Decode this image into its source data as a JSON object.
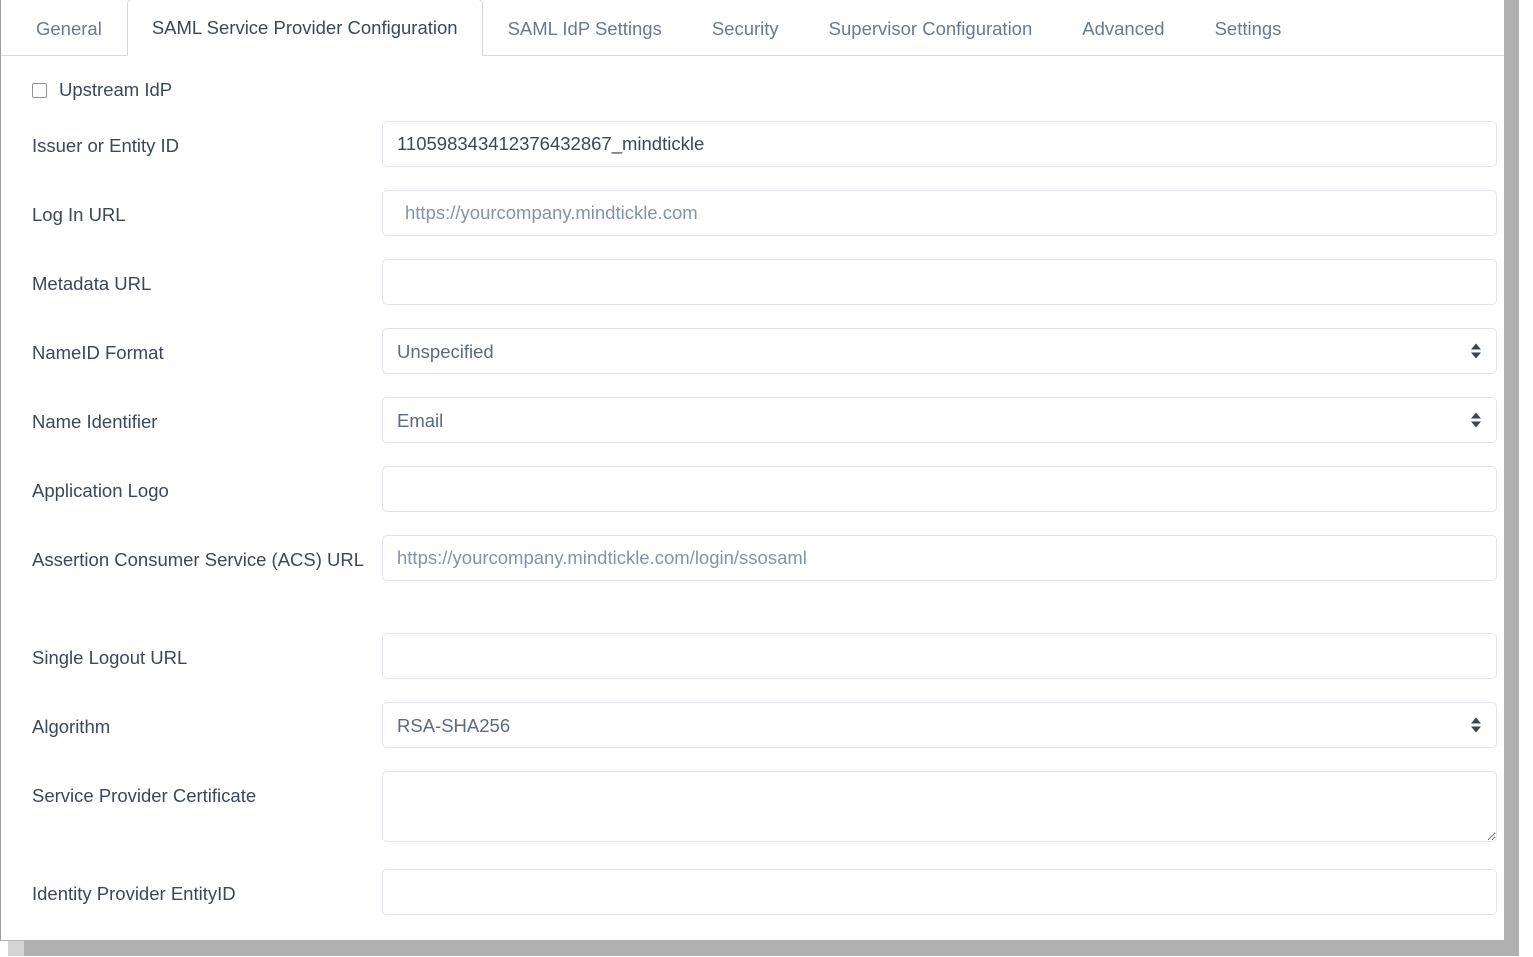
{
  "window": {
    "tabs": [
      {
        "label": "General",
        "active": false,
        "name": "tab-general"
      },
      {
        "label": "SAML Service Provider Configuration",
        "active": true,
        "name": "tab-saml-service-provider-configuration"
      },
      {
        "label": "SAML IdP Settings",
        "active": false,
        "name": "tab-saml-idp-settings"
      },
      {
        "label": "Security",
        "active": false,
        "name": "tab-security"
      },
      {
        "label": "Supervisor Configuration",
        "active": false,
        "name": "tab-supervisor-configuration"
      },
      {
        "label": "Advanced",
        "active": false,
        "name": "tab-advanced"
      },
      {
        "label": "Settings",
        "active": false,
        "name": "tab-settings"
      }
    ]
  },
  "colors": {
    "active_tab_text": "#3c4858",
    "inactive_tab_text": "#6c7a8d",
    "label_text": "#3c4858",
    "placeholder_text": "#8593a8",
    "field_border": "#e2e5e9",
    "scrollbar": "#b0b0b0"
  },
  "form": {
    "upstream_idp": {
      "label": "Upstream IdP",
      "checked": false
    },
    "fields": [
      {
        "label": "Issuer or Entity ID",
        "type": "text",
        "value": "110598343412376432867_mindtickle",
        "placeholder": "",
        "name": "issuer-or-entity-id"
      },
      {
        "label": "Log In URL",
        "type": "text",
        "value": "",
        "placeholder": "https://yourcompany.mindtickle.com",
        "name": "log-in-url"
      },
      {
        "label": "Metadata URL",
        "type": "text",
        "value": "",
        "placeholder": "",
        "name": "metadata-url"
      },
      {
        "label": "NameID Format",
        "type": "select",
        "value": "Unspecified",
        "options": [
          "Unspecified"
        ],
        "name": "nameid-format"
      },
      {
        "label": "Name Identifier",
        "type": "select",
        "value": "Email",
        "options": [
          "Email"
        ],
        "name": "name-identifier"
      },
      {
        "label": "Application Logo",
        "type": "text",
        "value": "",
        "placeholder": "",
        "name": "application-logo"
      },
      {
        "label": "Assertion Consumer Service (ACS) URL",
        "type": "text",
        "value": "",
        "placeholder": "https://yourcompany.mindtickle.com/login/ssosaml",
        "name": "assertion-consumer-service-acs-url"
      },
      {
        "label": "Single Logout URL",
        "type": "text",
        "value": "",
        "placeholder": "",
        "name": "single-logout-url"
      },
      {
        "label": "Algorithm",
        "type": "select",
        "value": "RSA-SHA256",
        "options": [
          "RSA-SHA256"
        ],
        "name": "algorithm"
      },
      {
        "label": "Service Provider Certificate",
        "type": "textarea",
        "value": "",
        "placeholder": "",
        "name": "service-provider-certificate"
      },
      {
        "label": "Identity Provider EntityID",
        "type": "text",
        "value": "",
        "placeholder": "",
        "name": "identity-provider-entityid"
      }
    ]
  }
}
